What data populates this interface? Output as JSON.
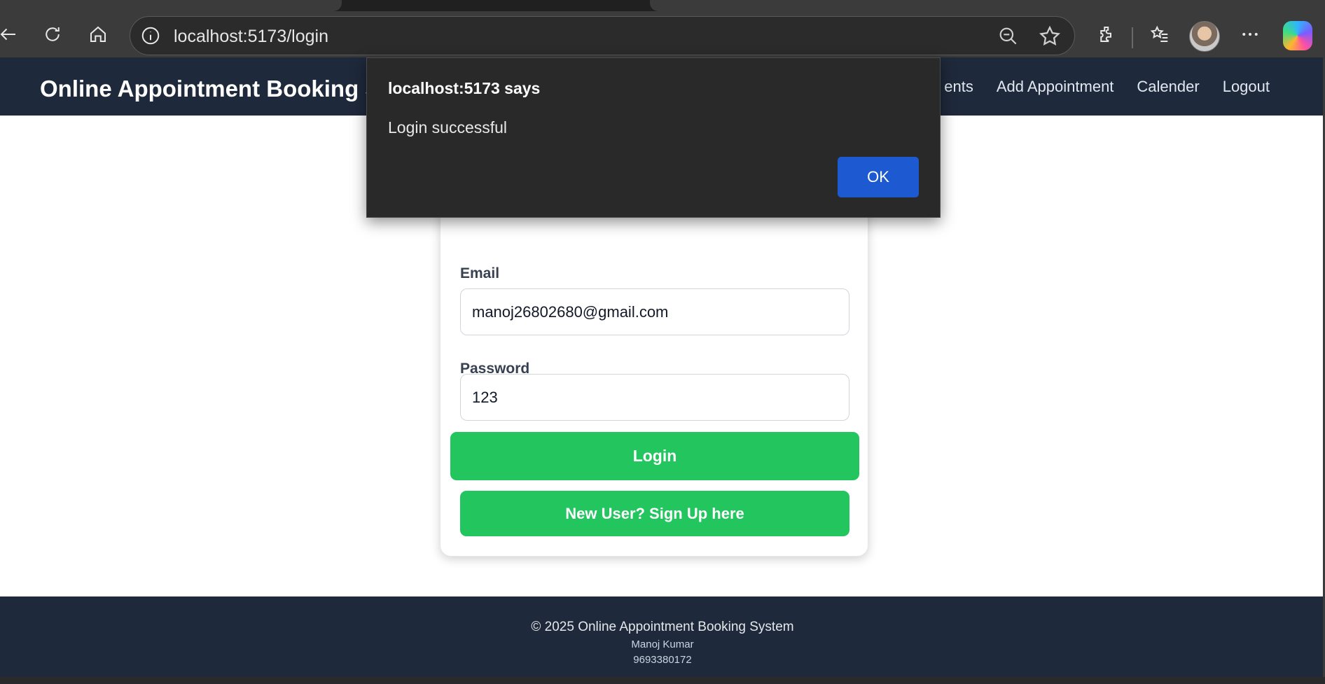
{
  "browser": {
    "url": "localhost:5173/login"
  },
  "navbar": {
    "brand": "Online Appointment Booking S",
    "links": [
      "ents",
      "Add Appointment",
      "Calender",
      "Logout"
    ]
  },
  "login_form": {
    "email_label_partial": "Email",
    "email_value": "manoj26802680@gmail.com",
    "password_label": "Password",
    "password_value": "123",
    "login_button": "Login",
    "signup_button": "New User? Sign Up here"
  },
  "footer": {
    "copyright": "© 2025 Online Appointment Booking System",
    "author": "Manoj Kumar",
    "phone": "9693380172"
  },
  "alert": {
    "title": "localhost:5173 says",
    "message": "Login successful",
    "ok_label": "OK"
  },
  "colors": {
    "navbar_bg": "#1e293b",
    "button_green": "#22c55e",
    "dialog_bg": "#292929",
    "ok_blue": "#1d59d1"
  }
}
